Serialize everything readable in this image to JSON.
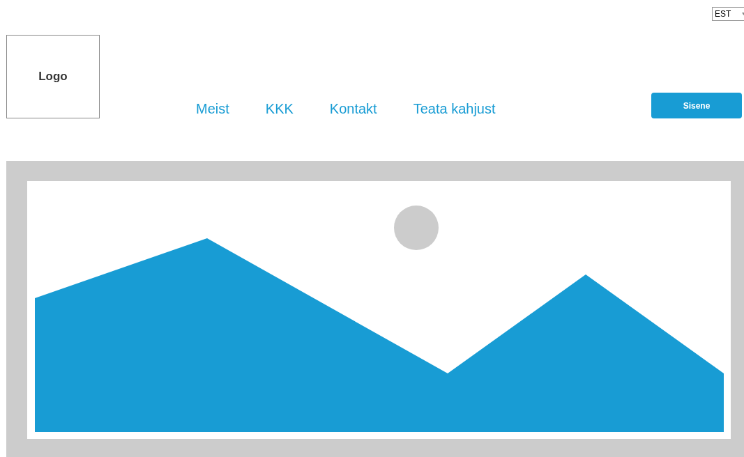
{
  "language_select": {
    "value": "EST"
  },
  "logo": {
    "label": "Logo"
  },
  "nav": [
    {
      "label": "Meist"
    },
    {
      "label": "KKK"
    },
    {
      "label": "Kontakt"
    },
    {
      "label": "Teata kahjust"
    }
  ],
  "login_button": {
    "label": "Sisene"
  }
}
